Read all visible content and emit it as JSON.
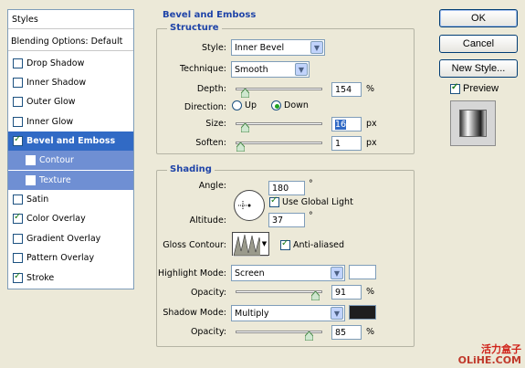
{
  "styles_panel": {
    "header": "Styles",
    "items": [
      {
        "label": "Blending Options: Default"
      },
      {
        "label": "Drop Shadow",
        "checked": false
      },
      {
        "label": "Inner Shadow",
        "checked": false
      },
      {
        "label": "Outer Glow",
        "checked": false
      },
      {
        "label": "Inner Glow",
        "checked": false
      },
      {
        "label": "Bevel and Emboss",
        "checked": true
      },
      {
        "label": "Contour",
        "checked": false
      },
      {
        "label": "Texture",
        "checked": false
      },
      {
        "label": "Satin",
        "checked": false
      },
      {
        "label": "Color Overlay",
        "checked": true
      },
      {
        "label": "Gradient Overlay",
        "checked": false
      },
      {
        "label": "Pattern Overlay",
        "checked": false
      },
      {
        "label": "Stroke",
        "checked": true
      }
    ]
  },
  "buttons": {
    "ok": "OK",
    "cancel": "Cancel",
    "new_style": "New Style..."
  },
  "preview": {
    "label": "Preview",
    "checked": true
  },
  "bevel": {
    "section_title": "Bevel and Emboss",
    "structure": {
      "title": "Structure",
      "style_label": "Style:",
      "style_value": "Inner Bevel",
      "technique_label": "Technique:",
      "technique_value": "Smooth",
      "depth_label": "Depth:",
      "depth_value": "154",
      "depth_unit": "%",
      "direction_label": "Direction:",
      "direction_up": "Up",
      "direction_down": "Down",
      "direction_selected": "Down",
      "size_label": "Size:",
      "size_value": "16",
      "size_unit": "px",
      "soften_label": "Soften:",
      "soften_value": "1",
      "soften_unit": "px"
    },
    "shading": {
      "title": "Shading",
      "angle_label": "Angle:",
      "angle_value": "180",
      "angle_unit": "°",
      "use_global_light": "Use Global Light",
      "altitude_label": "Altitude:",
      "altitude_value": "37",
      "altitude_unit": "°",
      "gloss_contour_label": "Gloss Contour:",
      "anti_aliased": "Anti-aliased",
      "highlight_mode_label": "Highlight Mode:",
      "highlight_mode_value": "Screen",
      "highlight_color": "#ffffff",
      "highlight_opacity_label": "Opacity:",
      "highlight_opacity_value": "91",
      "highlight_opacity_unit": "%",
      "shadow_mode_label": "Shadow Mode:",
      "shadow_mode_value": "Multiply",
      "shadow_color": "#1e1e1e",
      "shadow_opacity_label": "Opacity:",
      "shadow_opacity_value": "85",
      "shadow_opacity_unit": "%"
    }
  },
  "watermark": {
    "top": "活力盒子",
    "bottom": "OLiHE.COM"
  }
}
